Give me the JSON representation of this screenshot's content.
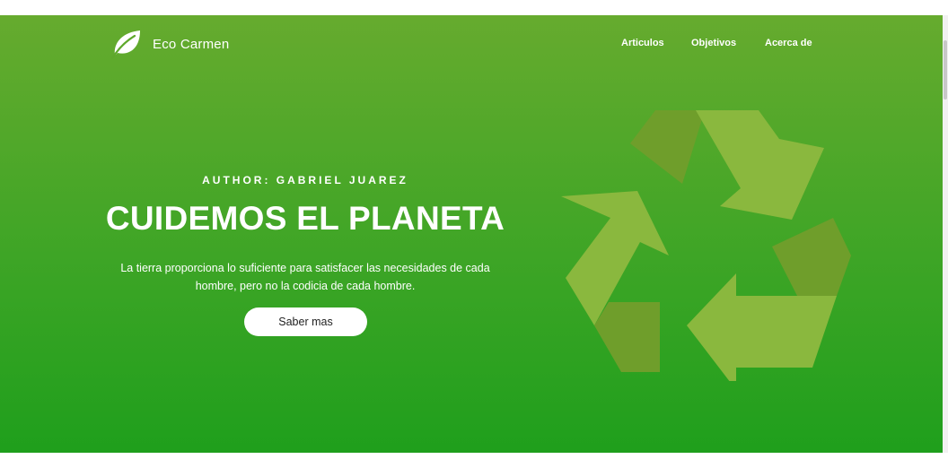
{
  "brand": {
    "name": "Eco Carmen",
    "icon": "leaf-icon"
  },
  "nav": {
    "items": [
      "Articulos",
      "Objetivos",
      "Acerca de"
    ]
  },
  "hero": {
    "author": "AUTHOR: GABRIEL JUAREZ",
    "title": "CUIDEMOS EL PLANETA",
    "subtitle_line1": "La tierra proporciona lo suficiente para satisfacer las necesidades de cada",
    "subtitle_line2": "hombre, pero no la codicia de cada hombre.",
    "cta_label": "Saber mas",
    "illustration": "recycle-icon"
  },
  "colors": {
    "hero_top": "#66ab2e",
    "hero_bottom": "#1f9f1c",
    "recycle_light": "#8ab83e",
    "recycle_dark": "#6f9e2b"
  }
}
